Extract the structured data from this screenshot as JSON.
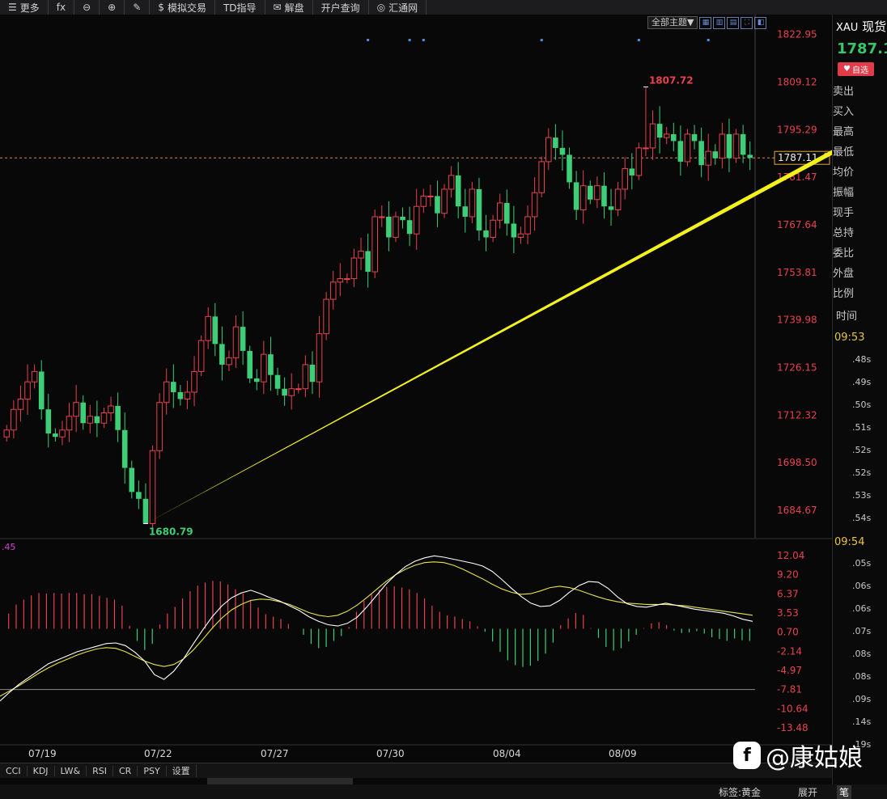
{
  "toolbar": {
    "items": [
      {
        "label": "更多",
        "icon": "menu-icon",
        "glyph": "☰"
      },
      {
        "label": "",
        "icon": "fx-icon",
        "glyph": "fx"
      },
      {
        "label": "",
        "icon": "zoom-out-icon",
        "glyph": "⊖"
      },
      {
        "label": "",
        "icon": "zoom-in-icon",
        "glyph": "⊕"
      },
      {
        "label": "",
        "icon": "pen-icon",
        "glyph": "✎"
      },
      {
        "label": "模拟交易",
        "icon": "dollar-icon",
        "glyph": "$"
      },
      {
        "label": "TD指导",
        "icon": "",
        "glyph": ""
      },
      {
        "label": "解盘",
        "icon": "chat-icon",
        "glyph": "✉"
      },
      {
        "label": "开户查询",
        "icon": "",
        "glyph": ""
      },
      {
        "label": "汇通网",
        "icon": "logo-icon",
        "glyph": "◎"
      }
    ]
  },
  "chart_top_controls": {
    "theme_button": "全部主题▼"
  },
  "right_panel": {
    "symbol_code": "XAU",
    "symbol_name": "现货",
    "price": "1787.1",
    "watch_label": "自选",
    "fields": [
      "卖出",
      "买入",
      "最高",
      "最低",
      "均价",
      "振幅",
      "现手",
      "总持",
      "委比",
      "外盘",
      "比例"
    ],
    "time_header": "时间",
    "times": [
      "09:53",
      "09:54"
    ],
    "ticks_1": [
      ".48s",
      ".49s",
      ".50s",
      ".51s",
      ".52s",
      ".52s",
      ".53s",
      ".54s"
    ],
    "ticks_2": [
      ".05s",
      ".06s",
      ".06s",
      ".07s",
      ".08s",
      ".08s",
      ".09s",
      ".14s",
      ".19s"
    ]
  },
  "bottom_indicators": [
    "CCI",
    "KDJ",
    "LW&",
    "RSI",
    "CR",
    "PSY",
    "设置"
  ],
  "status_bar": {
    "tag": "标签:黄金",
    "expand": "展开",
    "pen": "笔"
  },
  "watermark": "@康姑娘",
  "colors": {
    "up": "#e8414f",
    "down": "#3ccf78",
    "axis_red": "#e8414f",
    "arrow": "#f4f21b",
    "dif": "#ffffff",
    "dea": "#e8e34a"
  },
  "chart_data": [
    {
      "type": "candlestick",
      "price_axis": [
        "1822.95",
        "1809.12",
        "1795.29",
        "1781.47",
        "1767.64",
        "1753.81",
        "1739.98",
        "1726.15",
        "1712.32",
        "1698.50",
        "1684.67"
      ],
      "ylim": [
        1679.5,
        1825.0
      ],
      "x_labels": [
        "07/19",
        "07/22",
        "07/27",
        "07/30",
        "08/04",
        "08/09"
      ],
      "current_price_label": "1787.11",
      "current_price": 1787.11,
      "high_label": "1807.72",
      "low_label": "1680.79",
      "high_value": 1807.72,
      "low_value": 1680.79,
      "closes": [
        1708,
        1714,
        1717,
        1722,
        1725,
        1714,
        1707,
        1706,
        1708,
        1712,
        1716,
        1710,
        1712,
        1710,
        1713,
        1715,
        1708,
        1697,
        1690,
        1688,
        1680.8,
        1702,
        1716,
        1722,
        1719,
        1717,
        1719,
        1725,
        1734,
        1741,
        1733,
        1727,
        1729,
        1738,
        1731,
        1723,
        1722,
        1730,
        1724,
        1720,
        1718,
        1720,
        1720,
        1727,
        1722,
        1736,
        1746,
        1751,
        1752,
        1752,
        1758,
        1760,
        1754,
        1770,
        1770,
        1764,
        1770,
        1769,
        1765,
        1773,
        1776,
        1776,
        1771,
        1778,
        1782,
        1773,
        1770,
        1778,
        1766,
        1764,
        1769,
        1774,
        1768,
        1764,
        1765,
        1770,
        1777,
        1786,
        1793,
        1790,
        1788,
        1780,
        1772,
        1779,
        1775,
        1779,
        1773,
        1772,
        1778,
        1784,
        1782,
        1790,
        1790,
        1797,
        1793,
        1794,
        1792,
        1786,
        1794,
        1792,
        1785,
        1789,
        1787,
        1794,
        1787,
        1794,
        1788,
        1787.11
      ],
      "extremes": [
        [
          20,
          "low",
          1680.79
        ],
        [
          92,
          "high",
          1807.72
        ]
      ],
      "scatter_marks": [
        52,
        58,
        60,
        77,
        91,
        101,
        122
      ],
      "trend_arrow": {
        "from": [
          20,
          1680.79
        ],
        "to": [
          131,
          1802
        ]
      },
      "dashed_price_line": 1787.11
    },
    {
      "type": "macd",
      "value_axis": [
        "12.04",
        "9.20",
        "6.37",
        "3.53",
        "0.70",
        "-2.14",
        "-4.97",
        "-7.81",
        "-10.64",
        "-13.48"
      ],
      "ylim": [
        -13.48,
        12.04
      ],
      "top_left_value": ".45",
      "zero_line": -7.81,
      "hist": [
        2.5,
        4.0,
        4.8,
        5.5,
        5.9,
        5.8,
        5.9,
        5.8,
        5.9,
        5.9,
        5.7,
        5.7,
        5.4,
        5.1,
        4.8,
        3.8,
        0.5,
        -2.0,
        -3.5,
        -2.5,
        0.7,
        2.5,
        3.6,
        5.0,
        6.2,
        7.1,
        7.6,
        7.9,
        7.8,
        7.3,
        6.5,
        5.8,
        4.7,
        3.5,
        2.4,
        2.0,
        1.6,
        0.8,
        0.0,
        -1.0,
        -2.5,
        -3.2,
        -3.0,
        -2.0,
        -1.2,
        0.3,
        2.8,
        4.6,
        5.7,
        6.4,
        6.9,
        7.0,
        6.8,
        6.5,
        5.9,
        5.0,
        3.8,
        2.8,
        2.2,
        2.0,
        1.6,
        1.2,
        0.4,
        -0.5,
        -2.1,
        -3.8,
        -5.2,
        -6.0,
        -6.3,
        -6.1,
        -5.3,
        -4.1,
        -2.3,
        0.6,
        1.7,
        2.6,
        2.3,
        0.1,
        -1.5,
        -3.0,
        -3.6,
        -3.2,
        -2.1,
        -1.0,
        0.1,
        0.9,
        1.1,
        0.6,
        -0.3,
        -0.7,
        -0.6,
        -0.4,
        -0.8,
        -1.4,
        -1.7,
        -2.0,
        -1.6,
        -1.9,
        -2.0
      ],
      "dif": [
        -9.5,
        -8.2,
        -7.0,
        -6.0,
        -5.0,
        -4.0,
        -3.4,
        -2.8,
        -2.2,
        -1.8,
        -1.4,
        -1.0,
        -0.9,
        -1.3,
        -2.3,
        -3.6,
        -5.6,
        -6.3,
        -5.1,
        -3.3,
        -1.1,
        1.0,
        3.0,
        4.6,
        5.8,
        6.5,
        6.9,
        6.4,
        5.8,
        5.3,
        4.6,
        3.9,
        3.0,
        2.3,
        1.8,
        1.6,
        2.0,
        2.9,
        4.4,
        6.1,
        7.8,
        9.2,
        10.4,
        11.2,
        11.7,
        12.0,
        11.8,
        11.5,
        11.2,
        10.9,
        10.5,
        9.7,
        8.5,
        7.2,
        6.0,
        5.0,
        4.5,
        4.6,
        5.4,
        6.6,
        7.6,
        8.2,
        8.1,
        7.2,
        5.9,
        4.9,
        4.5,
        4.4,
        4.7,
        5.0,
        4.7,
        4.4,
        4.1,
        3.9,
        3.7,
        3.5,
        3.1,
        2.6,
        2.3
      ],
      "dea": [
        -8.8,
        -8.0,
        -7.2,
        -6.3,
        -5.4,
        -4.6,
        -3.9,
        -3.3,
        -2.7,
        -2.2,
        -1.8,
        -1.6,
        -1.7,
        -2.2,
        -2.9,
        -3.6,
        -4.1,
        -4.4,
        -4.1,
        -3.3,
        -2.0,
        -0.4,
        1.3,
        2.8,
        4.0,
        4.8,
        5.4,
        5.6,
        5.5,
        5.2,
        4.8,
        4.2,
        3.6,
        3.2,
        3.0,
        3.2,
        3.8,
        4.7,
        5.8,
        7.0,
        8.2,
        9.2,
        10.0,
        10.6,
        11.0,
        11.1,
        11.0,
        10.6,
        10.0,
        9.3,
        8.6,
        7.8,
        7.1,
        6.6,
        6.3,
        6.4,
        6.8,
        7.3,
        7.5,
        7.3,
        6.9,
        6.4,
        5.9,
        5.5,
        5.2,
        5.0,
        4.9,
        4.8,
        4.8,
        4.8,
        4.7,
        4.6,
        4.4,
        4.2,
        4.0,
        3.8,
        3.6,
        3.4,
        3.2
      ]
    }
  ]
}
